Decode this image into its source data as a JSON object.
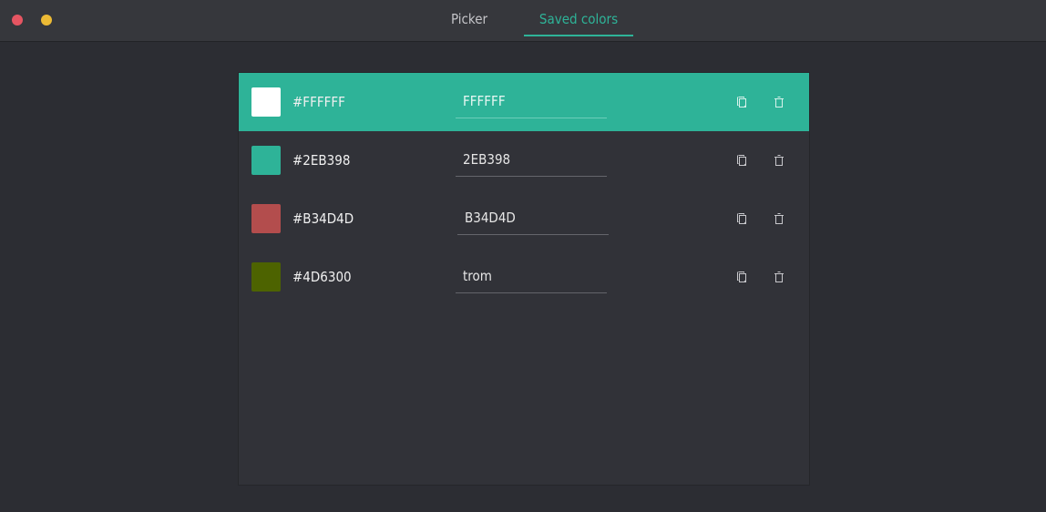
{
  "window": {
    "controls": [
      {
        "name": "close",
        "color": "#e65562"
      },
      {
        "name": "minimize",
        "color": "#ecba35"
      }
    ]
  },
  "tabs": [
    {
      "label": "Picker",
      "active": false
    },
    {
      "label": "Saved colors",
      "active": true
    }
  ],
  "accent": "#2eb398",
  "saved_colors": [
    {
      "hex_label": "#FFFFFF",
      "color": "#FFFFFF",
      "name_value": "FFFFFF",
      "selected": true,
      "copy_icon": "copy-icon",
      "delete_icon": "trash-icon"
    },
    {
      "hex_label": "#2EB398",
      "color": "#2EB398",
      "name_value": "2EB398",
      "selected": false,
      "copy_icon": "copy-icon",
      "delete_icon": "trash-icon"
    },
    {
      "hex_label": "#B34D4D",
      "color": "#B34D4D",
      "name_value": "B34D4D",
      "selected": false,
      "copy_icon": "copy-icon",
      "delete_icon": "trash-icon"
    },
    {
      "hex_label": "#4D6300",
      "color": "#4D6300",
      "name_value": "trom",
      "selected": false,
      "copy_icon": "copy-icon",
      "delete_icon": "trash-icon"
    }
  ]
}
